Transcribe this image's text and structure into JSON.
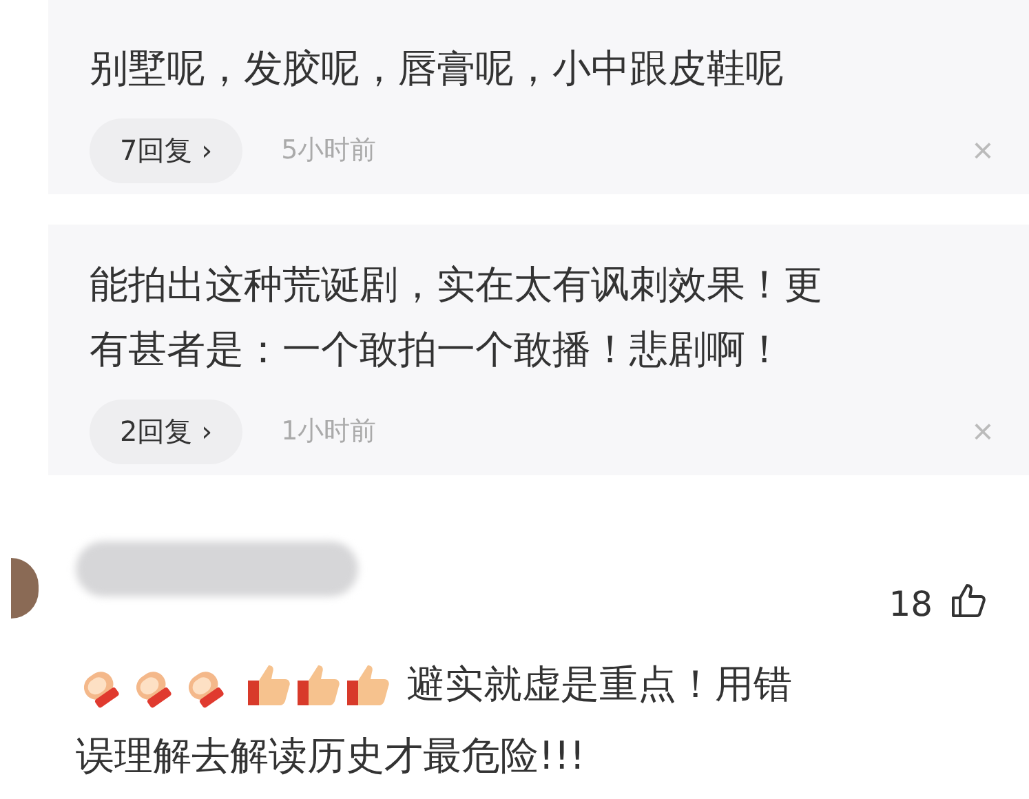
{
  "replies": [
    {
      "lines": [
        "别墅呢，发胶呢，唇膏呢，小中跟皮鞋呢"
      ],
      "reply_count": "7回复",
      "chevron": "›",
      "time": "5小时前",
      "close": "×"
    },
    {
      "lines": [
        "能拍出这种荒诞剧，实在太有讽刺效果！更",
        "有甚者是：一个敢拍一个敢播！悲剧啊！"
      ],
      "reply_count": "2回复",
      "chevron": "›",
      "time": "1小时前",
      "close": "×"
    }
  ],
  "comment": {
    "likes": "18",
    "lines": [
      "避实就虚是重点！用错",
      "误理解去解读历史才最危险!!!"
    ]
  }
}
